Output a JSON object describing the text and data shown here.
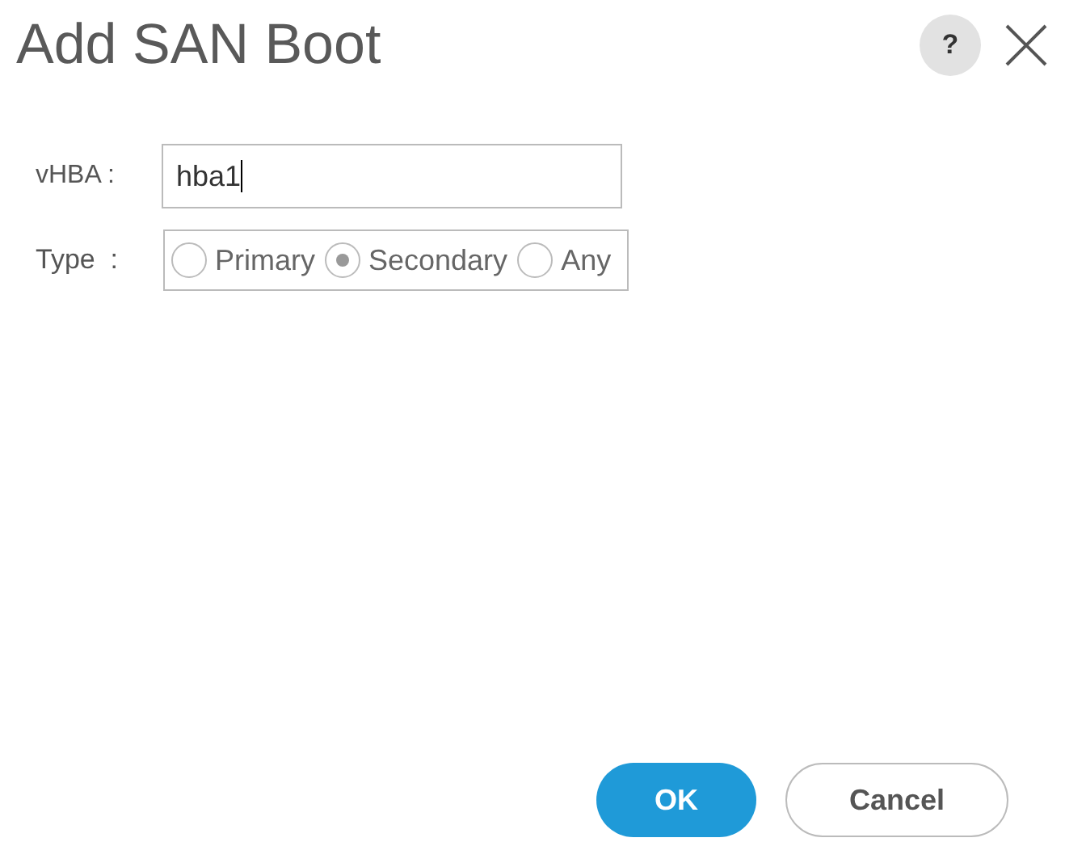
{
  "dialog": {
    "title": "Add SAN Boot",
    "help_label": "?"
  },
  "fields": {
    "vhba": {
      "label": "vHBA :",
      "value": "hba1"
    },
    "type": {
      "label": "Type  :",
      "options": [
        {
          "label": "Primary",
          "selected": false
        },
        {
          "label": "Secondary",
          "selected": true
        },
        {
          "label": "Any",
          "selected": false
        }
      ]
    }
  },
  "buttons": [
    {
      "label": "OK",
      "kind": "primary"
    },
    {
      "label": "Cancel",
      "kind": "secondary"
    }
  ]
}
